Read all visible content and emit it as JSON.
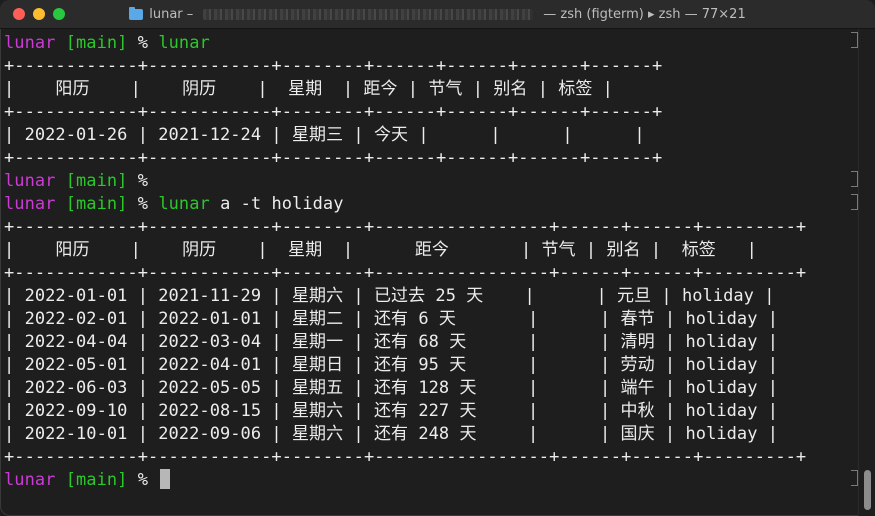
{
  "window": {
    "title_prefix": "lunar –",
    "title_suffix": "— zsh (figterm) ▸ zsh — 77×21"
  },
  "colors": {
    "prompt_name": "#cc3ad6",
    "prompt_branch": "#2bc72b",
    "text": "#ececec",
    "background": "#1e1e1e"
  },
  "terminal": {
    "prompt": {
      "name": "lunar",
      "branch": "[main]",
      "symbol": "%"
    },
    "lines": [
      {
        "kind": "prompt",
        "cmd": "lunar",
        "cmd_colored": true
      },
      {
        "kind": "text",
        "text": "+------------+------------+--------+------+------+------+------+"
      },
      {
        "kind": "text",
        "text": "|    阳历    |    阴历    |  星期  | 距今 | 节气 | 别名 | 标签 |"
      },
      {
        "kind": "text",
        "text": "+------------+------------+--------+------+------+------+------+"
      },
      {
        "kind": "text",
        "text": "| 2022-01-26 | 2021-12-24 | 星期三 | 今天 |      |      |      |"
      },
      {
        "kind": "text",
        "text": "+------------+------------+--------+------+------+------+------+"
      },
      {
        "kind": "prompt",
        "cmd": "",
        "cmd_colored": false
      },
      {
        "kind": "prompt",
        "cmd": "lunar",
        "cmd_colored": true,
        "args": " a -t holiday"
      },
      {
        "kind": "text",
        "text": "+------------+------------+--------+-----------------+------+------+---------+"
      },
      {
        "kind": "text",
        "text": "|    阳历    |    阴历    |  星期  |      距今       | 节气 | 别名 |  标签   |"
      },
      {
        "kind": "text",
        "text": "+------------+------------+--------+-----------------+------+------+---------+"
      },
      {
        "kind": "text",
        "text": "| 2022-01-01 | 2021-11-29 | 星期六 | 已过去 25 天    |      | 元旦 | holiday |"
      },
      {
        "kind": "text",
        "text": "| 2022-02-01 | 2022-01-01 | 星期二 | 还有 6 天       |      | 春节 | holiday |"
      },
      {
        "kind": "text",
        "text": "| 2022-04-04 | 2022-03-04 | 星期一 | 还有 68 天      |      | 清明 | holiday |"
      },
      {
        "kind": "text",
        "text": "| 2022-05-01 | 2022-04-01 | 星期日 | 还有 95 天      |      | 劳动 | holiday |"
      },
      {
        "kind": "text",
        "text": "| 2022-06-03 | 2022-05-05 | 星期五 | 还有 128 天     |      | 端午 | holiday |"
      },
      {
        "kind": "text",
        "text": "| 2022-09-10 | 2022-08-15 | 星期六 | 还有 227 天     |      | 中秋 | holiday |"
      },
      {
        "kind": "text",
        "text": "| 2022-10-01 | 2022-09-06 | 星期六 | 还有 248 天     |      | 国庆 | holiday |"
      },
      {
        "kind": "text",
        "text": "+------------+------------+--------+-----------------+------+------+---------+"
      },
      {
        "kind": "prompt",
        "cmd": "",
        "cmd_colored": false,
        "cursor": true
      }
    ]
  }
}
